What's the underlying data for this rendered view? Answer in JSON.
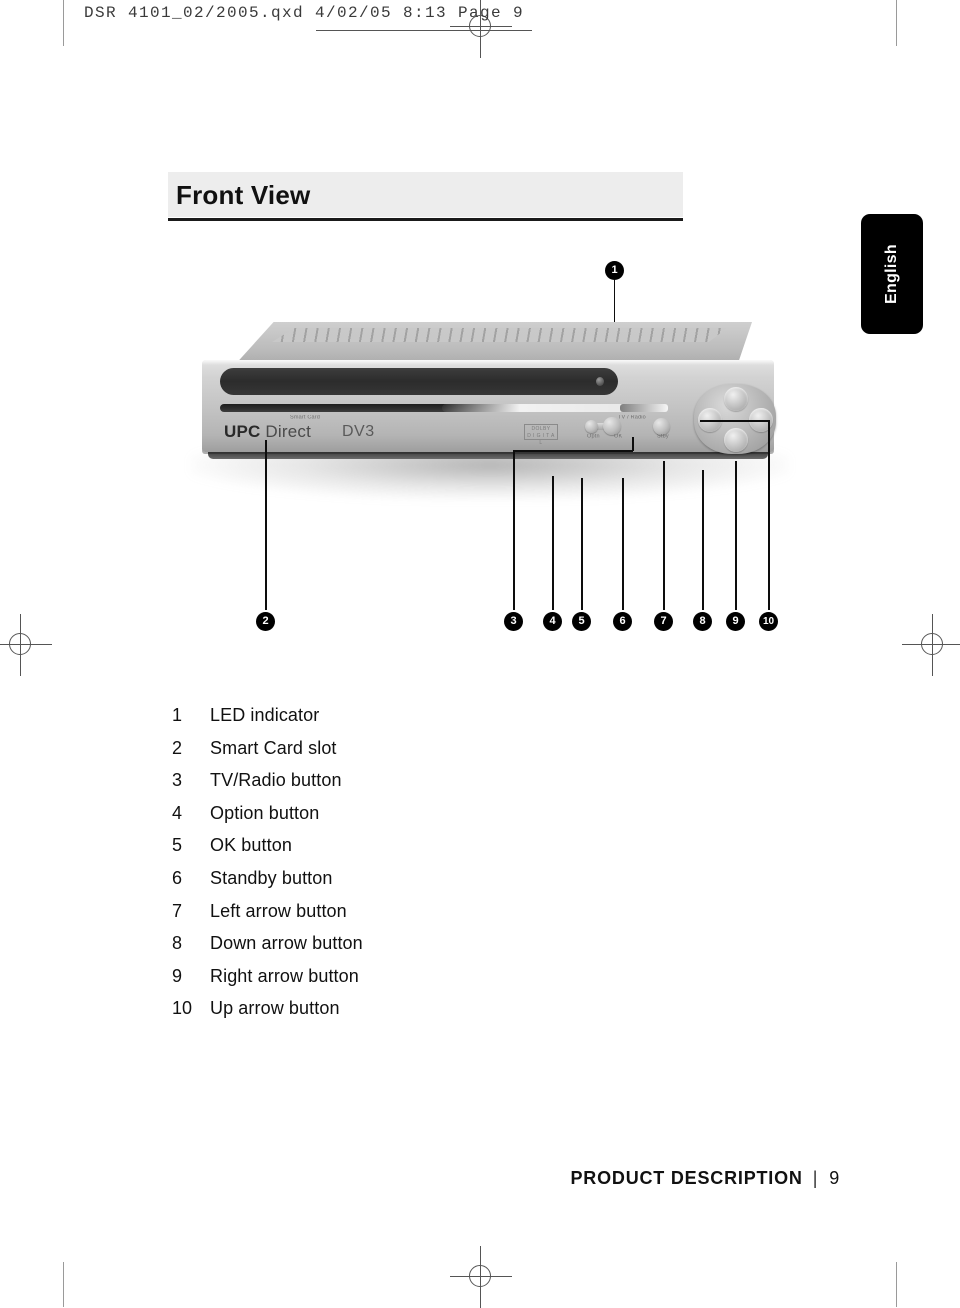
{
  "file_header": {
    "text": "DSR 4101_02/2005.qxd   4/02/05   8:13   Page  9"
  },
  "section": {
    "title": "Front View"
  },
  "language_tab": {
    "label": "English"
  },
  "device": {
    "brand_bold": "UPC",
    "brand_rest": " Direct",
    "model": "DV3",
    "dolby_line1": "DOLBY",
    "dolby_line2": "D I G I T A L",
    "smart_card_label": "Smart Card",
    "tv_radio_label": "TV / Radio",
    "option_label": "Optn",
    "ok_label": "OK",
    "standby_label": "Stby"
  },
  "callouts": [
    {
      "num": "1"
    },
    {
      "num": "2"
    },
    {
      "num": "3"
    },
    {
      "num": "4"
    },
    {
      "num": "5"
    },
    {
      "num": "6"
    },
    {
      "num": "7"
    },
    {
      "num": "8"
    },
    {
      "num": "9"
    },
    {
      "num": "10"
    }
  ],
  "legend": [
    {
      "num": "1",
      "text": "LED indicator"
    },
    {
      "num": "2",
      "text": "Smart Card slot"
    },
    {
      "num": "3",
      "text": "TV/Radio button"
    },
    {
      "num": "4",
      "text": "Option button"
    },
    {
      "num": "5",
      "text": "OK button"
    },
    {
      "num": "6",
      "text": "Standby button"
    },
    {
      "num": "7",
      "text": "Left arrow button"
    },
    {
      "num": "8",
      "text": "Down arrow button"
    },
    {
      "num": "9",
      "text": "Right arrow button"
    },
    {
      "num": "10",
      "text": "Up arrow button"
    }
  ],
  "footer": {
    "section_name": "PRODUCT DESCRIPTION",
    "divider": "|",
    "page_number": "9"
  }
}
